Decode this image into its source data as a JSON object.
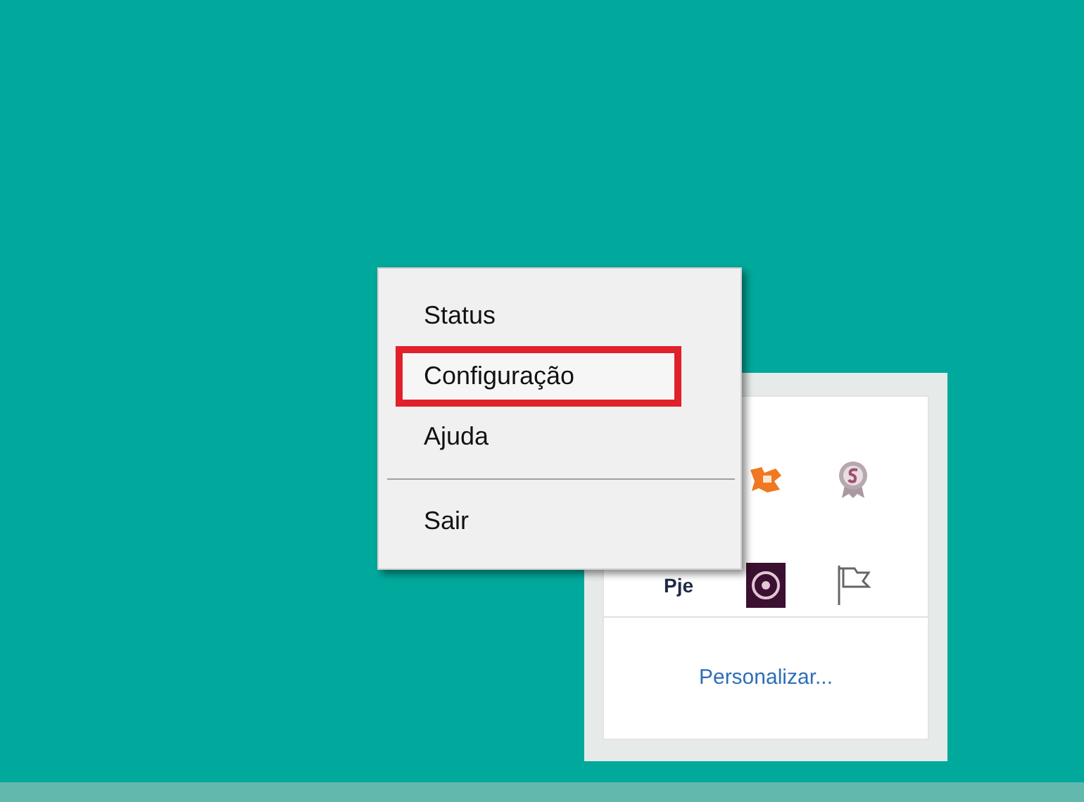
{
  "tray_overflow": {
    "label_icon_text": "Pje",
    "customize_link": "Personalizar..."
  },
  "context_menu": {
    "items": [
      {
        "kind": "item",
        "label": "Status",
        "highlighted": false
      },
      {
        "kind": "item",
        "label": "Configuração",
        "highlighted": true
      },
      {
        "kind": "item",
        "label": "Ajuda",
        "highlighted": false
      },
      {
        "kind": "separator"
      },
      {
        "kind": "item",
        "label": "Sair",
        "highlighted": false
      }
    ]
  }
}
